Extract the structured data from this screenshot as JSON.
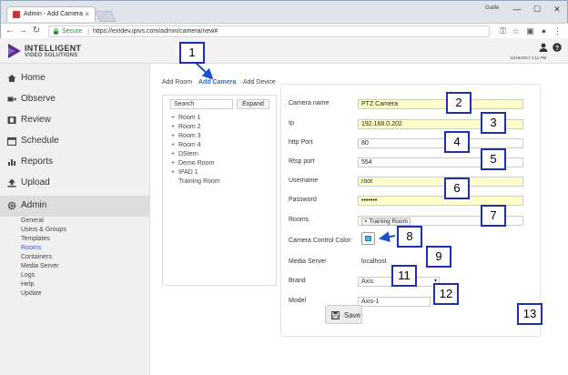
{
  "browser": {
    "tab_title": "Admin - Add Camera",
    "tab_close": "×",
    "user_label": "Guille",
    "window_controls": [
      "—",
      "☐",
      "✕"
    ],
    "nav": {
      "back": "←",
      "forward": "→",
      "reload": "↻"
    },
    "secure_label": "Secure",
    "url": "https://extdev.ipivs.com/admin/camera/new#"
  },
  "app": {
    "brand_line1": "INTELLIGENT",
    "brand_line2": "VIDEO SOLUTIONS",
    "date": "12/16/2017 1:11 PM",
    "brand_color": "#5a2a8c"
  },
  "sidebar": {
    "items": [
      {
        "label": "Home",
        "icon": "home-icon"
      },
      {
        "label": "Observe",
        "icon": "video-camera-icon"
      },
      {
        "label": "Review",
        "icon": "film-icon"
      },
      {
        "label": "Schedule",
        "icon": "calendar-icon"
      },
      {
        "label": "Reports",
        "icon": "bar-chart-icon"
      },
      {
        "label": "Upload",
        "icon": "upload-icon"
      },
      {
        "label": "Admin",
        "icon": "gear-icon"
      }
    ],
    "admin_sub": [
      "General",
      "Users & Groups",
      "Templates",
      "Rooms",
      "Containers",
      "Media Server",
      "Logs",
      "Help",
      "Update"
    ]
  },
  "tabs": {
    "add_room": "Add Room",
    "add_camera": "Add Camera",
    "add_device": "Add Device"
  },
  "tree": {
    "search_placeholder": "Search",
    "expand_label": "Expand",
    "items": [
      "Room 1",
      "Room 2",
      "Room 3",
      "Room 4",
      "DStern",
      "Demo Room",
      "IPAD 1",
      "Training Room"
    ]
  },
  "form": {
    "camera_name": {
      "label": "Camera name",
      "value": "PTZ Camera"
    },
    "ip": {
      "label": "Ip",
      "value": "192.168.0.202"
    },
    "http_port": {
      "label": "http Port",
      "value": "80"
    },
    "rtsp_port": {
      "label": "Rtsp port",
      "value": "554"
    },
    "username": {
      "label": "Username",
      "value": "root"
    },
    "password": {
      "label": "Password",
      "value": "•••••••"
    },
    "rooms": {
      "label": "Rooms",
      "value": "Training Room",
      "remove": "×"
    },
    "camera_control_color": {
      "label": "Camera Control Color:",
      "color": "#3fb8e0"
    },
    "media_server": {
      "label": "Media Server",
      "value": "localhost"
    },
    "brand": {
      "label": "Brand",
      "value": "Axis"
    },
    "model": {
      "label": "Model",
      "value": "Axis-1"
    },
    "save_label": "Save"
  },
  "callouts": [
    "1",
    "2",
    "3",
    "4",
    "5",
    "6",
    "7",
    "8",
    "9",
    "11",
    "12",
    "13"
  ]
}
